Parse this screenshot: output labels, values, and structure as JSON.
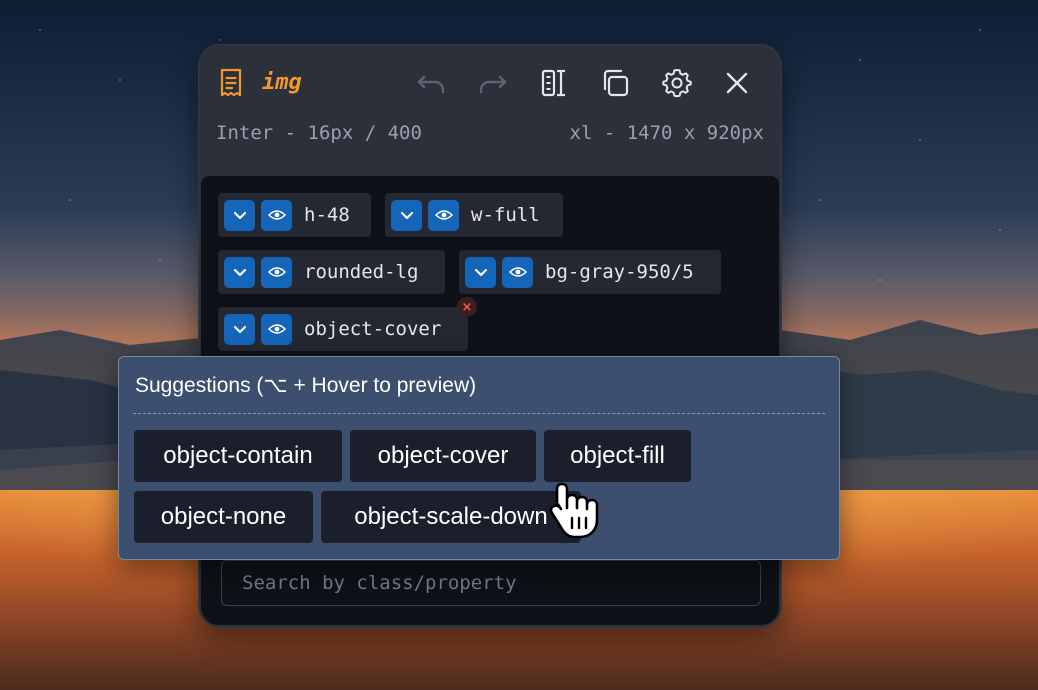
{
  "panel": {
    "tag_name": "img",
    "icons": {
      "tag": "receipt-icon",
      "undo": "undo-icon",
      "redo": "redo-icon",
      "split": "split-view-icon",
      "copy": "copy-icon",
      "settings": "gear-icon",
      "close": "close-icon"
    },
    "font_info": "Inter - 16px / 400",
    "breakpoint_info": "xl - 1470 x 920px",
    "accent_color": "#f4982a"
  },
  "classes": [
    {
      "label": "h-48"
    },
    {
      "label": "w-full"
    },
    {
      "label": "rounded-lg"
    },
    {
      "label": "bg-gray-950/5"
    },
    {
      "label": "object-cover",
      "remove_label": "×"
    }
  ],
  "search": {
    "placeholder": "Search by class/property"
  },
  "suggestions": {
    "title": "Suggestions (⌥ + Hover to preview)",
    "options": [
      "object-contain",
      "object-cover",
      "object-fill",
      "object-none",
      "object-scale-down"
    ]
  }
}
